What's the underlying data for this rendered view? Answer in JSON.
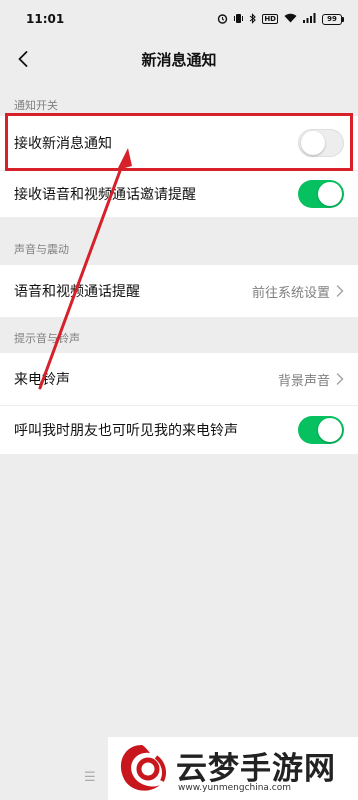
{
  "status_bar": {
    "time": "11:01",
    "icons": [
      "alarm-icon",
      "vibrate-icon",
      "bluetooth-icon",
      "hd-icon",
      "wifi-icon",
      "signal-icon"
    ],
    "hd_label": "HD",
    "battery_level": "99"
  },
  "nav": {
    "title": "新消息通知",
    "back_icon": "chevron-left-icon"
  },
  "sections": [
    {
      "header": "通知开关",
      "rows": [
        {
          "label": "接收新消息通知",
          "control": "toggle",
          "on": false,
          "highlighted": true
        },
        {
          "label": "接收语音和视频通话邀请提醒",
          "control": "toggle",
          "on": true
        }
      ]
    },
    {
      "header": "声音与震动",
      "rows": [
        {
          "label": "语音和视频通话提醒",
          "control": "link",
          "value": "前往系统设置"
        }
      ]
    },
    {
      "header": "提示音与铃声",
      "rows": [
        {
          "label": "来电铃声",
          "control": "link",
          "value": "背景声音"
        },
        {
          "label": "呼叫我时朋友也可听见我的来电铃声",
          "control": "toggle",
          "on": true
        }
      ]
    }
  ],
  "colors": {
    "accent": "#07c160",
    "highlight": "#d6202a",
    "background": "#ededed"
  },
  "bottom": {
    "handle": "☰"
  },
  "watermark": {
    "title": "云梦手游网",
    "url": "www.yunmengchina.com"
  }
}
